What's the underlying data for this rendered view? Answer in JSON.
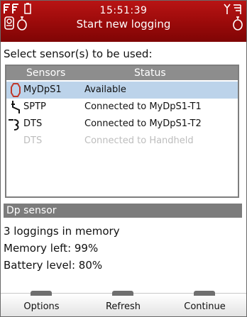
{
  "header": {
    "time": "15:51:39",
    "title": "Start new logging",
    "icons": [
      "signal-bars-icon",
      "battery-icon",
      "sensor-icon",
      "stopwatch-icon",
      "antenna-icon"
    ]
  },
  "prompt": "Select sensor(s) to be used:",
  "sensor_list": {
    "columns": [
      "Sensors",
      "Status"
    ],
    "rows": [
      {
        "icon": "dp-sensor-icon",
        "name": "MyDpS1",
        "status": "Available",
        "selected": true,
        "enabled": true
      },
      {
        "icon": "temperature-probe-icon",
        "name": "SPTP",
        "status": "Connected to MyDpS1-T1",
        "selected": false,
        "enabled": true
      },
      {
        "icon": "temperature-probe-icon",
        "name": "DTS",
        "status": "Connected to MyDpS1-T2",
        "selected": false,
        "enabled": true
      },
      {
        "icon": "",
        "name": "DTS",
        "status": "Connected to Handheld",
        "selected": false,
        "enabled": false
      }
    ]
  },
  "details": {
    "heading": "Dp sensor",
    "loggings": "3 loggings in memory",
    "memory": "Memory left: 99%",
    "battery": "Battery level: 80%"
  },
  "softkeys": {
    "left": "Options",
    "middle": "Refresh",
    "right": "Continue"
  },
  "colors": {
    "header": "#9a0a0a",
    "selection": "#bcd3ea",
    "list_header": "#8d8d8d",
    "panel_header": "#7c7c7c",
    "disabled_text": "#bdbdbd"
  }
}
